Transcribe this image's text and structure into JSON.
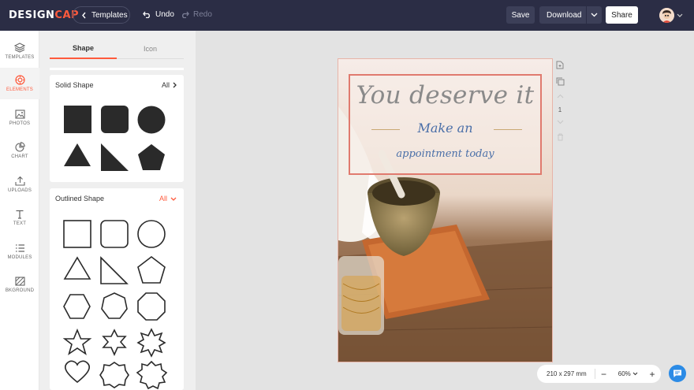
{
  "header": {
    "logo_main": "DESIGN",
    "logo_accent": "CAP",
    "templates_label": "Templates",
    "undo_label": "Undo",
    "redo_label": "Redo",
    "save_label": "Save",
    "download_label": "Download",
    "share_label": "Share"
  },
  "sidebar": {
    "items": [
      {
        "label": "TEMPLATES",
        "icon": "layers-icon"
      },
      {
        "label": "ELEMENTS",
        "icon": "elements-icon",
        "active": true
      },
      {
        "label": "PHOTOS",
        "icon": "photo-icon"
      },
      {
        "label": "CHART",
        "icon": "pie-chart-icon"
      },
      {
        "label": "UPLOADS",
        "icon": "upload-icon"
      },
      {
        "label": "TEXT",
        "icon": "text-icon"
      },
      {
        "label": "MODULES",
        "icon": "modules-icon"
      },
      {
        "label": "BKGROUND",
        "icon": "background-icon"
      }
    ]
  },
  "panel": {
    "tabs": [
      {
        "label": "Shape",
        "active": true
      },
      {
        "label": "Icon",
        "active": false
      }
    ],
    "solid": {
      "title": "Solid Shape",
      "all_label": "All",
      "shapes": [
        "square-shape",
        "rounded-square-shape",
        "circle-shape",
        "triangle-shape",
        "right-triangle-shape",
        "pentagon-shape"
      ]
    },
    "outlined": {
      "title": "Outlined Shape",
      "all_label": "All",
      "shapes": [
        "square-outline",
        "rounded-square-outline",
        "circle-outline",
        "triangle-outline",
        "right-triangle-outline",
        "pentagon-outline",
        "hexagon-outline",
        "heptagon-outline",
        "octagon-outline",
        "star5-outline",
        "star6-outline",
        "star8-outline",
        "heart-outline",
        "badge-outline",
        "burst-outline"
      ]
    }
  },
  "poster": {
    "headline": "You deserve it",
    "line1": "Make an",
    "line2": "appointment today"
  },
  "page_tools": {
    "page_number": "1"
  },
  "zoom": {
    "page_size": "210 x 297 mm",
    "minus": "−",
    "level": "60%",
    "plus": "+"
  },
  "colors": {
    "topbar": "#2b2d45",
    "accent": "#ff5a3c",
    "frame": "#e07a6e",
    "script_gray": "#8a8a8a",
    "script_blue": "#4a6fa8"
  }
}
